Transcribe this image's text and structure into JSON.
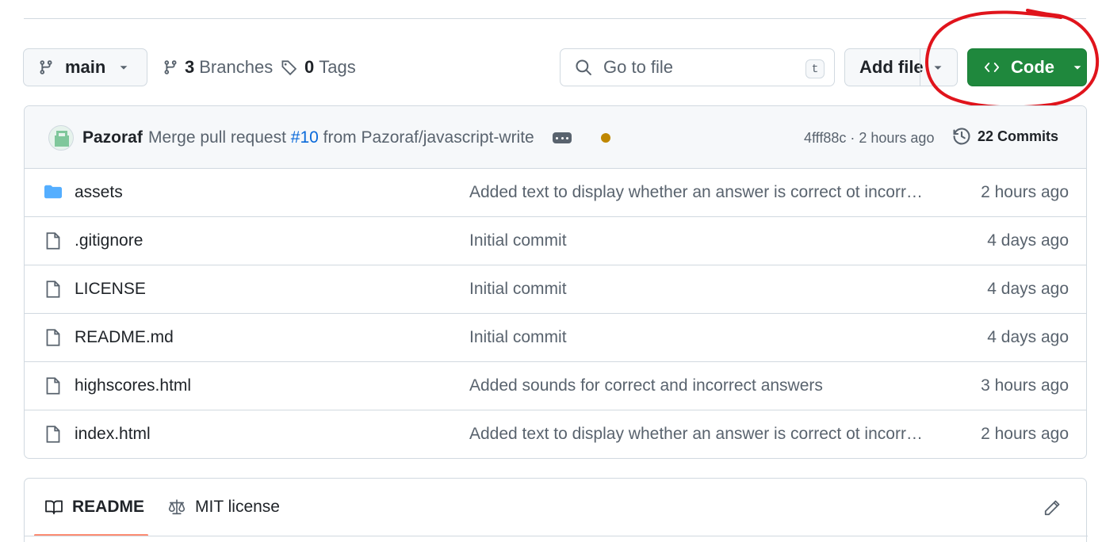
{
  "toolbar": {
    "branch": "main",
    "branches_count": "3",
    "branches_label": "Branches",
    "tags_count": "0",
    "tags_label": "Tags",
    "search_placeholder": "Go to file",
    "search_shortcut": "t",
    "add_file_label": "Add file",
    "code_label": "Code"
  },
  "commit": {
    "author": "Pazoraf",
    "message_prefix": "Merge pull request",
    "pr_number": "#10",
    "message_suffix": "from Pazoraf/javascript-write",
    "sha_time": "4fff88c · 2 hours ago",
    "commits_label": "22 Commits"
  },
  "files": [
    {
      "name": "assets",
      "type": "folder",
      "message": "Added text to display whether an answer is correct ot incorr…",
      "time": "2 hours ago"
    },
    {
      "name": ".gitignore",
      "type": "file",
      "message": "Initial commit",
      "time": "4 days ago"
    },
    {
      "name": "LICENSE",
      "type": "file",
      "message": "Initial commit",
      "time": "4 days ago"
    },
    {
      "name": "README.md",
      "type": "file",
      "message": "Initial commit",
      "time": "4 days ago"
    },
    {
      "name": "highscores.html",
      "type": "file",
      "message": "Added sounds for correct and incorrect answers",
      "time": "3 hours ago"
    },
    {
      "name": "index.html",
      "type": "file",
      "message": "Added text to display whether an answer is correct ot incorr…",
      "time": "2 hours ago"
    }
  ],
  "readme": {
    "tab_readme": "README",
    "tab_license": "MIT license"
  },
  "colors": {
    "code_button": "#1f883d",
    "annotation": "#e0141c",
    "folder": "#54aeff",
    "link": "#0969da",
    "status_pending": "#bf8700"
  }
}
